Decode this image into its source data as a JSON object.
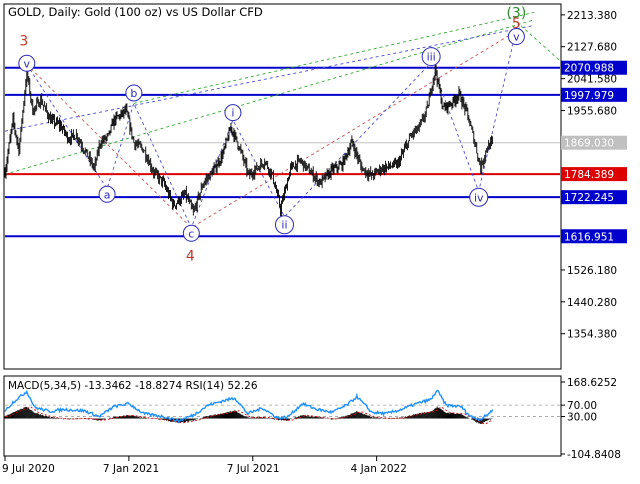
{
  "header": {
    "symbol_line": "GOLD, Daily:  Gold (100 oz) vs US Dollar CFD",
    "macd_label": "MACD(5,34,5) -13.3462 -18.8274 RSI(14) 52.26"
  },
  "chart_data": [
    {
      "type": "line",
      "title": "GOLD, Daily:  Gold (100 oz) vs US Dollar CFD",
      "x_tick_labels": [
        "9 Jul 2020",
        "7 Jan 2021",
        "7 Jul 2021",
        "4 Jan 2022"
      ],
      "x_tick_index": [
        0,
        125,
        250,
        375
      ],
      "y_tick_labels": [
        2213.38,
        2127.68,
        2041.58,
        1955.68,
        1526.18,
        1440.28,
        1354.38
      ],
      "ylim": [
        1262.0,
        2240.0
      ],
      "grid": false,
      "horizontal_levels": [
        {
          "value": 2070.988,
          "label": "2070.988",
          "color": "#0000cc"
        },
        {
          "value": 1997.979,
          "label": "1997.979",
          "color": "#0000cc"
        },
        {
          "value": 1869.03,
          "label": "1869.030",
          "color": "#c0c0c0"
        },
        {
          "value": 1784.389,
          "label": "1784.389",
          "color": "#dd0000"
        },
        {
          "value": 1722.245,
          "label": "1722.245",
          "color": "#0000cc"
        },
        {
          "value": 1616.951,
          "label": "1616.951",
          "color": "#0000cc"
        }
      ],
      "price_anchors": [
        {
          "i": 0,
          "v": 1790
        },
        {
          "i": 8,
          "v": 1930
        },
        {
          "i": 14,
          "v": 1850
        },
        {
          "i": 22,
          "v": 2060
        },
        {
          "i": 28,
          "v": 1955
        },
        {
          "i": 36,
          "v": 1985
        },
        {
          "i": 46,
          "v": 1930
        },
        {
          "i": 56,
          "v": 1915
        },
        {
          "i": 64,
          "v": 1880
        },
        {
          "i": 72,
          "v": 1890
        },
        {
          "i": 80,
          "v": 1850
        },
        {
          "i": 90,
          "v": 1800
        },
        {
          "i": 96,
          "v": 1870
        },
        {
          "i": 104,
          "v": 1885
        },
        {
          "i": 110,
          "v": 1930
        },
        {
          "i": 122,
          "v": 1955
        },
        {
          "i": 130,
          "v": 1870
        },
        {
          "i": 140,
          "v": 1850
        },
        {
          "i": 150,
          "v": 1790
        },
        {
          "i": 160,
          "v": 1760
        },
        {
          "i": 170,
          "v": 1700
        },
        {
          "i": 182,
          "v": 1730
        },
        {
          "i": 190,
          "v": 1680
        },
        {
          "i": 200,
          "v": 1760
        },
        {
          "i": 212,
          "v": 1800
        },
        {
          "i": 220,
          "v": 1840
        },
        {
          "i": 228,
          "v": 1910
        },
        {
          "i": 236,
          "v": 1860
        },
        {
          "i": 246,
          "v": 1780
        },
        {
          "i": 254,
          "v": 1800
        },
        {
          "i": 262,
          "v": 1820
        },
        {
          "i": 270,
          "v": 1780
        },
        {
          "i": 278,
          "v": 1690
        },
        {
          "i": 288,
          "v": 1800
        },
        {
          "i": 298,
          "v": 1820
        },
        {
          "i": 308,
          "v": 1790
        },
        {
          "i": 318,
          "v": 1760
        },
        {
          "i": 330,
          "v": 1795
        },
        {
          "i": 340,
          "v": 1810
        },
        {
          "i": 350,
          "v": 1870
        },
        {
          "i": 360,
          "v": 1800
        },
        {
          "i": 370,
          "v": 1780
        },
        {
          "i": 380,
          "v": 1800
        },
        {
          "i": 396,
          "v": 1810
        },
        {
          "i": 410,
          "v": 1890
        },
        {
          "i": 418,
          "v": 1910
        },
        {
          "i": 426,
          "v": 1960
        },
        {
          "i": 434,
          "v": 2070
        },
        {
          "i": 442,
          "v": 1960
        },
        {
          "i": 452,
          "v": 1980
        },
        {
          "i": 458,
          "v": 2000
        },
        {
          "i": 466,
          "v": 1950
        },
        {
          "i": 474,
          "v": 1870
        },
        {
          "i": 480,
          "v": 1800
        },
        {
          "i": 486,
          "v": 1855
        },
        {
          "i": 492,
          "v": 1869
        }
      ],
      "wave_labels": [
        {
          "text": "3",
          "style": "plain",
          "color": "#c0392b",
          "i": 19,
          "v": 2145
        },
        {
          "text": "v",
          "style": "circle",
          "color": "#2b2bb8",
          "i": 22,
          "v": 2083
        },
        {
          "text": "b",
          "style": "circle",
          "color": "#2b2bb8",
          "i": 130,
          "v": 2003
        },
        {
          "text": "a",
          "style": "circle",
          "color": "#2b2bb8",
          "i": 103,
          "v": 1730
        },
        {
          "text": "c",
          "style": "circle",
          "color": "#2b2bb8",
          "i": 188,
          "v": 1625
        },
        {
          "text": "4",
          "style": "plain",
          "color": "#c0392b",
          "i": 187,
          "v": 1565
        },
        {
          "text": "i",
          "style": "circle",
          "color": "#2b2bb8",
          "i": 230,
          "v": 1950
        },
        {
          "text": "ii",
          "style": "circle",
          "color": "#2b2bb8",
          "i": 282,
          "v": 1648
        },
        {
          "text": "iii",
          "style": "circle",
          "color": "#2b2bb8",
          "i": 430,
          "v": 2101
        },
        {
          "text": "iv",
          "style": "circle",
          "color": "#2b2bb8",
          "i": 478,
          "v": 1722
        },
        {
          "text": "(3)",
          "style": "plain",
          "color": "#2e8b2e",
          "i": 516,
          "v": 2220
        },
        {
          "text": "5",
          "style": "plain",
          "color": "#c0392b",
          "i": 516,
          "v": 2192
        },
        {
          "text": "v",
          "style": "circle",
          "color": "#2b2bb8",
          "i": 516,
          "v": 2155
        }
      ],
      "wave_paths": [
        {
          "color": "#cc5555",
          "dash": "3,3",
          "points": [
            [
              22,
              2080
            ],
            [
              188,
              1640
            ],
            [
              516,
              2170
            ]
          ]
        },
        {
          "color": "#4a4ad8",
          "dash": "3,3",
          "points": [
            [
              22,
              2080
            ],
            [
              103,
              1745
            ],
            [
              130,
              1975
            ],
            [
              188,
              1640
            ],
            [
              230,
              1930
            ],
            [
              282,
              1670
            ],
            [
              430,
              2085
            ],
            [
              478,
              1738
            ],
            [
              516,
              2175
            ]
          ]
        },
        {
          "color": "#33aa33",
          "dash": "3,3",
          "points": [
            [
              0,
              1784
            ],
            [
              534,
              2200
            ]
          ]
        },
        {
          "color": "#33aa33",
          "dash": "3,3",
          "points": [
            [
              130,
              1975
            ],
            [
              534,
              2220
            ]
          ]
        },
        {
          "color": "#33aa33",
          "dash": "3,3",
          "points": [
            [
              516,
              2195
            ],
            [
              560,
              2090
            ]
          ]
        },
        {
          "color": "#4a4ad8",
          "dash": "3,3",
          "points": [
            [
              0,
              1900
            ],
            [
              534,
              2185
            ]
          ]
        }
      ]
    },
    {
      "type": "area",
      "title": "MACD(5,34,5) -13.3462 -18.8274 RSI(14) 52.26",
      "y_tick_labels": [
        168.6252,
        70.0,
        30.0,
        -104.8408
      ],
      "ylim": [
        -104.8408,
        168.6252
      ],
      "macd_value": -13.3462,
      "signal_value": -18.8274,
      "rsi_value": 52.26,
      "grid_levels": [
        70.0,
        30.0
      ],
      "macd_anchors": [
        {
          "i": 0,
          "v": 0
        },
        {
          "i": 10,
          "v": 40
        },
        {
          "i": 22,
          "v": 75
        },
        {
          "i": 30,
          "v": 30
        },
        {
          "i": 45,
          "v": -5
        },
        {
          "i": 60,
          "v": -20
        },
        {
          "i": 80,
          "v": -15
        },
        {
          "i": 95,
          "v": -30
        },
        {
          "i": 110,
          "v": -5
        },
        {
          "i": 125,
          "v": 10
        },
        {
          "i": 140,
          "v": -10
        },
        {
          "i": 160,
          "v": -25
        },
        {
          "i": 175,
          "v": -50
        },
        {
          "i": 190,
          "v": -30
        },
        {
          "i": 205,
          "v": 5
        },
        {
          "i": 220,
          "v": 25
        },
        {
          "i": 232,
          "v": 45
        },
        {
          "i": 245,
          "v": -10
        },
        {
          "i": 260,
          "v": -5
        },
        {
          "i": 275,
          "v": -25
        },
        {
          "i": 285,
          "v": -30
        },
        {
          "i": 300,
          "v": 10
        },
        {
          "i": 315,
          "v": -5
        },
        {
          "i": 330,
          "v": -20
        },
        {
          "i": 345,
          "v": 5
        },
        {
          "i": 355,
          "v": 40
        },
        {
          "i": 370,
          "v": -5
        },
        {
          "i": 385,
          "v": -15
        },
        {
          "i": 400,
          "v": -10
        },
        {
          "i": 415,
          "v": 20
        },
        {
          "i": 430,
          "v": 40
        },
        {
          "i": 436,
          "v": 75
        },
        {
          "i": 445,
          "v": 30
        },
        {
          "i": 460,
          "v": 20
        },
        {
          "i": 470,
          "v": -20
        },
        {
          "i": 480,
          "v": -60
        },
        {
          "i": 486,
          "v": -35
        },
        {
          "i": 492,
          "v": -13
        }
      ],
      "rsi_anchors": [
        {
          "i": 0,
          "v": 50
        },
        {
          "i": 8,
          "v": 80
        },
        {
          "i": 22,
          "v": 118
        },
        {
          "i": 30,
          "v": 62
        },
        {
          "i": 45,
          "v": 48
        },
        {
          "i": 60,
          "v": 55
        },
        {
          "i": 80,
          "v": 50
        },
        {
          "i": 95,
          "v": 30
        },
        {
          "i": 110,
          "v": 65
        },
        {
          "i": 125,
          "v": 75
        },
        {
          "i": 140,
          "v": 40
        },
        {
          "i": 160,
          "v": 30
        },
        {
          "i": 175,
          "v": 15
        },
        {
          "i": 190,
          "v": 35
        },
        {
          "i": 205,
          "v": 70
        },
        {
          "i": 220,
          "v": 85
        },
        {
          "i": 232,
          "v": 95
        },
        {
          "i": 245,
          "v": 40
        },
        {
          "i": 260,
          "v": 60
        },
        {
          "i": 275,
          "v": 25
        },
        {
          "i": 285,
          "v": 28
        },
        {
          "i": 300,
          "v": 75
        },
        {
          "i": 315,
          "v": 55
        },
        {
          "i": 330,
          "v": 45
        },
        {
          "i": 345,
          "v": 70
        },
        {
          "i": 355,
          "v": 100
        },
        {
          "i": 370,
          "v": 45
        },
        {
          "i": 385,
          "v": 40
        },
        {
          "i": 400,
          "v": 55
        },
        {
          "i": 415,
          "v": 75
        },
        {
          "i": 430,
          "v": 90
        },
        {
          "i": 436,
          "v": 122
        },
        {
          "i": 445,
          "v": 70
        },
        {
          "i": 460,
          "v": 65
        },
        {
          "i": 470,
          "v": 30
        },
        {
          "i": 480,
          "v": 20
        },
        {
          "i": 486,
          "v": 35
        },
        {
          "i": 492,
          "v": 52
        }
      ]
    }
  ]
}
